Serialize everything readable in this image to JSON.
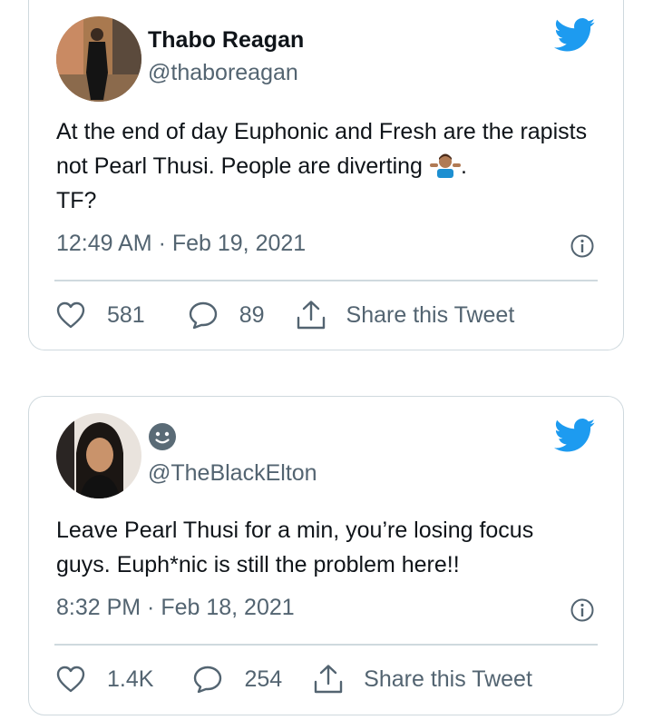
{
  "tweets": [
    {
      "name": "Thabo Reagan",
      "handle": "@thaboreagan",
      "text_before_emoji": "At the end of day Euphonic and Fresh are the rapists not Pearl Thusi. People are diverting",
      "emoji": "person-shrugging-emoji",
      "text_after_emoji": ".",
      "text_line3": "TF?",
      "timestamp": "12:49 AM · Feb 19, 2021",
      "likes": "581",
      "replies": "89",
      "share_label": "Share this Tweet"
    },
    {
      "name": "",
      "name_emoji": "slightly-smiling-face-emoji",
      "handle": "@TheBlackElton",
      "text": "Leave Pearl Thusi for a min, you’re losing focus guys. Euph*nic is still the problem here!!",
      "timestamp": "8:32 PM · Feb 18, 2021",
      "likes": "1.4K",
      "replies": "254",
      "share_label": "Share this Tweet"
    }
  ],
  "colors": {
    "twitter_blue": "#1d9bf0",
    "secondary_text": "#536471",
    "border": "#cfd9de"
  }
}
